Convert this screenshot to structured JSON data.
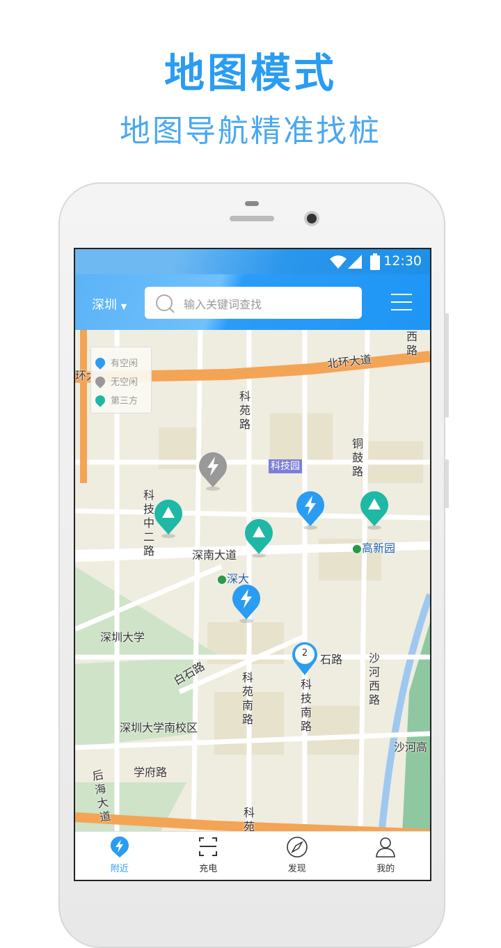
{
  "promo": {
    "title": "地图模式",
    "subtitle": "地图导航精准找桩"
  },
  "status_bar": {
    "time": "12:30",
    "icons": [
      "wifi-icon",
      "signal-icon",
      "battery-icon"
    ]
  },
  "header": {
    "city": "深圳",
    "search_placeholder": "输入关键词查找",
    "menu_icon": "menu-icon"
  },
  "legend": [
    {
      "label": "有空闲",
      "color": "#2a9cf2"
    },
    {
      "label": "无空闲",
      "color": "#999999"
    },
    {
      "label": "第三方",
      "color": "#1fb8a5"
    }
  ],
  "map_labels": [
    "北环大道",
    "西路",
    "环大",
    "科苑路",
    "科技园",
    "铜鼓路",
    "科技中二路",
    "深南大道",
    "高新园",
    "深大",
    "深圳大学",
    "石路",
    "沙河西路",
    "白石路",
    "科苑南路",
    "科技南路",
    "深圳大学南校区",
    "沙河高",
    "学府路",
    "后海大道",
    "科苑"
  ],
  "cluster": {
    "count": "2"
  },
  "colors": {
    "accent": "#2a9cf2",
    "available": "#2a9cf2",
    "busy": "#999999",
    "third_party": "#1fb8a5",
    "road": "#f4a455"
  },
  "tabs": [
    {
      "label": "附近",
      "icon": "lightning-pin-icon",
      "active": true
    },
    {
      "label": "充电",
      "icon": "scan-icon"
    },
    {
      "label": "发现",
      "icon": "compass-icon"
    },
    {
      "label": "我的",
      "icon": "user-icon"
    }
  ]
}
